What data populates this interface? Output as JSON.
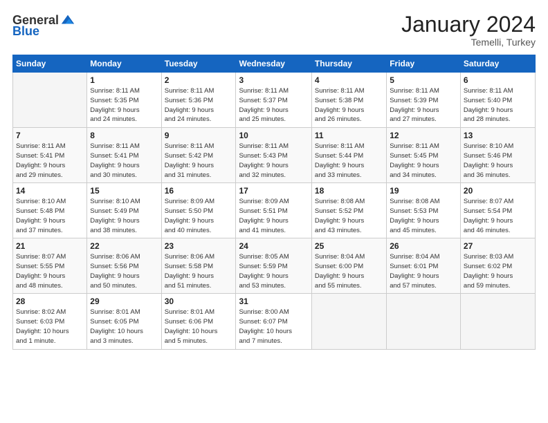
{
  "header": {
    "logo_general": "General",
    "logo_blue": "Blue",
    "month_title": "January 2024",
    "location": "Temelli, Turkey"
  },
  "days_of_week": [
    "Sunday",
    "Monday",
    "Tuesday",
    "Wednesday",
    "Thursday",
    "Friday",
    "Saturday"
  ],
  "weeks": [
    [
      {
        "day": "",
        "info": ""
      },
      {
        "day": "1",
        "info": "Sunrise: 8:11 AM\nSunset: 5:35 PM\nDaylight: 9 hours\nand 24 minutes."
      },
      {
        "day": "2",
        "info": "Sunrise: 8:11 AM\nSunset: 5:36 PM\nDaylight: 9 hours\nand 24 minutes."
      },
      {
        "day": "3",
        "info": "Sunrise: 8:11 AM\nSunset: 5:37 PM\nDaylight: 9 hours\nand 25 minutes."
      },
      {
        "day": "4",
        "info": "Sunrise: 8:11 AM\nSunset: 5:38 PM\nDaylight: 9 hours\nand 26 minutes."
      },
      {
        "day": "5",
        "info": "Sunrise: 8:11 AM\nSunset: 5:39 PM\nDaylight: 9 hours\nand 27 minutes."
      },
      {
        "day": "6",
        "info": "Sunrise: 8:11 AM\nSunset: 5:40 PM\nDaylight: 9 hours\nand 28 minutes."
      }
    ],
    [
      {
        "day": "7",
        "info": "Sunrise: 8:11 AM\nSunset: 5:41 PM\nDaylight: 9 hours\nand 29 minutes."
      },
      {
        "day": "8",
        "info": "Sunrise: 8:11 AM\nSunset: 5:41 PM\nDaylight: 9 hours\nand 30 minutes."
      },
      {
        "day": "9",
        "info": "Sunrise: 8:11 AM\nSunset: 5:42 PM\nDaylight: 9 hours\nand 31 minutes."
      },
      {
        "day": "10",
        "info": "Sunrise: 8:11 AM\nSunset: 5:43 PM\nDaylight: 9 hours\nand 32 minutes."
      },
      {
        "day": "11",
        "info": "Sunrise: 8:11 AM\nSunset: 5:44 PM\nDaylight: 9 hours\nand 33 minutes."
      },
      {
        "day": "12",
        "info": "Sunrise: 8:11 AM\nSunset: 5:45 PM\nDaylight: 9 hours\nand 34 minutes."
      },
      {
        "day": "13",
        "info": "Sunrise: 8:10 AM\nSunset: 5:46 PM\nDaylight: 9 hours\nand 36 minutes."
      }
    ],
    [
      {
        "day": "14",
        "info": "Sunrise: 8:10 AM\nSunset: 5:48 PM\nDaylight: 9 hours\nand 37 minutes."
      },
      {
        "day": "15",
        "info": "Sunrise: 8:10 AM\nSunset: 5:49 PM\nDaylight: 9 hours\nand 38 minutes."
      },
      {
        "day": "16",
        "info": "Sunrise: 8:09 AM\nSunset: 5:50 PM\nDaylight: 9 hours\nand 40 minutes."
      },
      {
        "day": "17",
        "info": "Sunrise: 8:09 AM\nSunset: 5:51 PM\nDaylight: 9 hours\nand 41 minutes."
      },
      {
        "day": "18",
        "info": "Sunrise: 8:08 AM\nSunset: 5:52 PM\nDaylight: 9 hours\nand 43 minutes."
      },
      {
        "day": "19",
        "info": "Sunrise: 8:08 AM\nSunset: 5:53 PM\nDaylight: 9 hours\nand 45 minutes."
      },
      {
        "day": "20",
        "info": "Sunrise: 8:07 AM\nSunset: 5:54 PM\nDaylight: 9 hours\nand 46 minutes."
      }
    ],
    [
      {
        "day": "21",
        "info": "Sunrise: 8:07 AM\nSunset: 5:55 PM\nDaylight: 9 hours\nand 48 minutes."
      },
      {
        "day": "22",
        "info": "Sunrise: 8:06 AM\nSunset: 5:56 PM\nDaylight: 9 hours\nand 50 minutes."
      },
      {
        "day": "23",
        "info": "Sunrise: 8:06 AM\nSunset: 5:58 PM\nDaylight: 9 hours\nand 51 minutes."
      },
      {
        "day": "24",
        "info": "Sunrise: 8:05 AM\nSunset: 5:59 PM\nDaylight: 9 hours\nand 53 minutes."
      },
      {
        "day": "25",
        "info": "Sunrise: 8:04 AM\nSunset: 6:00 PM\nDaylight: 9 hours\nand 55 minutes."
      },
      {
        "day": "26",
        "info": "Sunrise: 8:04 AM\nSunset: 6:01 PM\nDaylight: 9 hours\nand 57 minutes."
      },
      {
        "day": "27",
        "info": "Sunrise: 8:03 AM\nSunset: 6:02 PM\nDaylight: 9 hours\nand 59 minutes."
      }
    ],
    [
      {
        "day": "28",
        "info": "Sunrise: 8:02 AM\nSunset: 6:03 PM\nDaylight: 10 hours\nand 1 minute."
      },
      {
        "day": "29",
        "info": "Sunrise: 8:01 AM\nSunset: 6:05 PM\nDaylight: 10 hours\nand 3 minutes."
      },
      {
        "day": "30",
        "info": "Sunrise: 8:01 AM\nSunset: 6:06 PM\nDaylight: 10 hours\nand 5 minutes."
      },
      {
        "day": "31",
        "info": "Sunrise: 8:00 AM\nSunset: 6:07 PM\nDaylight: 10 hours\nand 7 minutes."
      },
      {
        "day": "",
        "info": ""
      },
      {
        "day": "",
        "info": ""
      },
      {
        "day": "",
        "info": ""
      }
    ]
  ]
}
